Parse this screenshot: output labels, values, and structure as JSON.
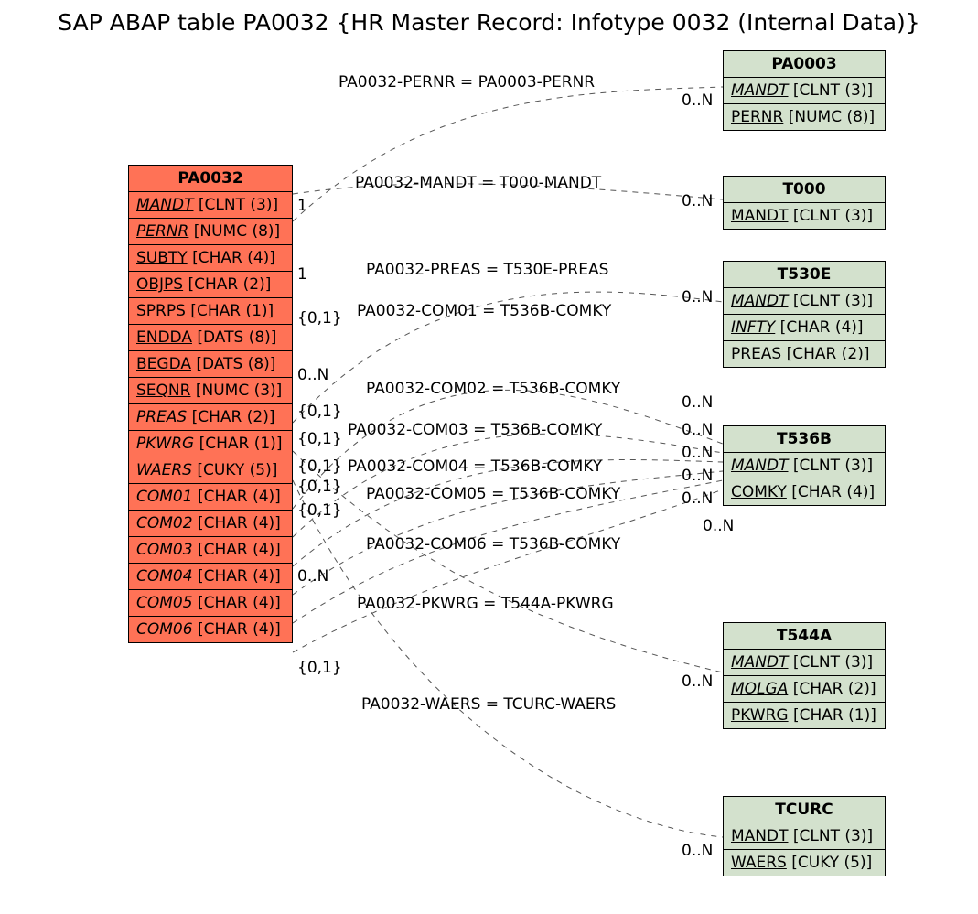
{
  "title": "SAP ABAP table PA0032 {HR Master Record: Infotype 0032 (Internal Data)}",
  "main": {
    "name": "PA0032",
    "rows": [
      {
        "decor": "fk",
        "text": "MANDT [CLNT (3)]"
      },
      {
        "decor": "fk",
        "text": "PERNR [NUMC (8)]"
      },
      {
        "decor": "ul",
        "text": "SUBTY [CHAR (4)]"
      },
      {
        "decor": "ul",
        "text": "OBJPS [CHAR (2)]"
      },
      {
        "decor": "ul",
        "text": "SPRPS [CHAR (1)]"
      },
      {
        "decor": "ul",
        "text": "ENDDA [DATS (8)]"
      },
      {
        "decor": "ul",
        "text": "BEGDA [DATS (8)]"
      },
      {
        "decor": "ul",
        "text": "SEQNR [NUMC (3)]"
      },
      {
        "decor": "it",
        "text": "PREAS [CHAR (2)]"
      },
      {
        "decor": "it",
        "text": "PKWRG [CHAR (1)]"
      },
      {
        "decor": "it",
        "text": "WAERS [CUKY (5)]"
      },
      {
        "decor": "it",
        "text": "COM01 [CHAR (4)]"
      },
      {
        "decor": "it",
        "text": "COM02 [CHAR (4)]"
      },
      {
        "decor": "it",
        "text": "COM03 [CHAR (4)]"
      },
      {
        "decor": "it",
        "text": "COM04 [CHAR (4)]"
      },
      {
        "decor": "it",
        "text": "COM05 [CHAR (4)]"
      },
      {
        "decor": "it",
        "text": "COM06 [CHAR (4)]"
      }
    ]
  },
  "rels": {
    "pa0003": {
      "name": "PA0003",
      "rows": [
        {
          "decor": "fk",
          "text": "MANDT [CLNT (3)]"
        },
        {
          "decor": "ul",
          "text": "PERNR [NUMC (8)]"
        }
      ]
    },
    "t000": {
      "name": "T000",
      "rows": [
        {
          "decor": "ul",
          "text": "MANDT [CLNT (3)]"
        }
      ]
    },
    "t530e": {
      "name": "T530E",
      "rows": [
        {
          "decor": "fk",
          "text": "MANDT [CLNT (3)]"
        },
        {
          "decor": "fk",
          "text": "INFTY [CHAR (4)]"
        },
        {
          "decor": "ul",
          "text": "PREAS [CHAR (2)]"
        }
      ]
    },
    "t536b": {
      "name": "T536B",
      "rows": [
        {
          "decor": "fk",
          "text": "MANDT [CLNT (3)]"
        },
        {
          "decor": "ul",
          "text": "COMKY [CHAR (4)]"
        }
      ]
    },
    "t544a": {
      "name": "T544A",
      "rows": [
        {
          "decor": "fk",
          "text": "MANDT [CLNT (3)]"
        },
        {
          "decor": "fk",
          "text": "MOLGA [CHAR (2)]"
        },
        {
          "decor": "ul",
          "text": "PKWRG [CHAR (1)]"
        }
      ]
    },
    "tcurc": {
      "name": "TCURC",
      "rows": [
        {
          "decor": "ul",
          "text": "MANDT [CLNT (3)]"
        },
        {
          "decor": "ul",
          "text": "WAERS [CUKY (5)]"
        }
      ]
    }
  },
  "edges": {
    "e1": {
      "label": "PA0032-PERNR = PA0003-PERNR",
      "lc": "1",
      "rc": "0..N"
    },
    "e2": {
      "label": "PA0032-MANDT = T000-MANDT",
      "lc": "1",
      "rc": "0..N"
    },
    "e3": {
      "label": "PA0032-PREAS = T530E-PREAS",
      "lc": "0..N",
      "rc": "0..N"
    },
    "e4": {
      "label": "PA0032-COM01 = T536B-COMKY",
      "lc": "{0,1}",
      "rc": "0..N"
    },
    "e5": {
      "label": "PA0032-COM02 = T536B-COMKY",
      "lc": "{0,1}",
      "rc": "0..N"
    },
    "e6": {
      "label": "PA0032-COM03 = T536B-COMKY",
      "lc": "{0,1}",
      "rc": "0..N"
    },
    "e7": {
      "label": "PA0032-COM04 = T536B-COMKY",
      "lc": "{0,1}",
      "rc": "0..N"
    },
    "e8": {
      "label": "PA0032-COM05 = T536B-COMKY",
      "lc": "{0,1}",
      "rc": "0..N"
    },
    "e9": {
      "label": "PA0032-COM06 = T536B-COMKY",
      "lc": "{0,1}",
      "rc": "0..N"
    },
    "e10": {
      "label": "PA0032-PKWRG = T544A-PKWRG",
      "lc": "0..N",
      "rc": "0..N"
    },
    "e11": {
      "label": "PA0032-WAERS = TCURC-WAERS",
      "lc": "{0,1}",
      "rc": "0..N"
    }
  }
}
